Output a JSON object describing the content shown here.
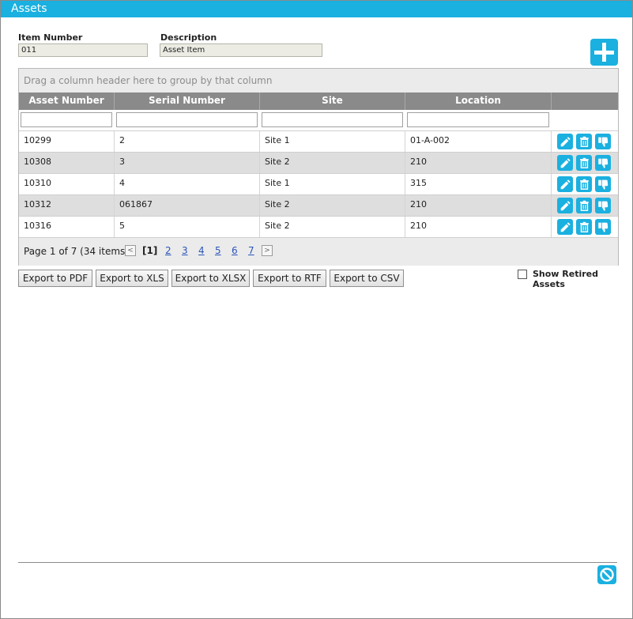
{
  "window": {
    "title": "Assets"
  },
  "fields": {
    "item_number_label": "Item Number",
    "item_number_value": "011",
    "description_label": "Description",
    "description_value": "Asset Item"
  },
  "grid": {
    "group_hint": "Drag a column header here to group by that column",
    "columns": [
      "Asset Number",
      "Serial Number",
      "Site",
      "Location"
    ],
    "rows": [
      {
        "asset_number": "10299",
        "serial_number": "2",
        "site": "Site 1",
        "location": "01-A-002"
      },
      {
        "asset_number": "10308",
        "serial_number": "3",
        "site": "Site 2",
        "location": "210"
      },
      {
        "asset_number": "10310",
        "serial_number": "4",
        "site": "Site 1",
        "location": "315"
      },
      {
        "asset_number": "10312",
        "serial_number": "061867",
        "site": "Site 2",
        "location": "210"
      },
      {
        "asset_number": "10316",
        "serial_number": "5",
        "site": "Site 2",
        "location": "210"
      }
    ],
    "row_action_icons": [
      "pencil-icon",
      "trash-icon",
      "thumbs-down-icon"
    ],
    "pager": {
      "summary": "Page 1 of 7 (34 items)",
      "prev": "<",
      "next": ">",
      "current": "[1]",
      "pages": [
        "2",
        "3",
        "4",
        "5",
        "6",
        "7"
      ]
    }
  },
  "exports": [
    "Export to PDF",
    "Export to XLS",
    "Export to XLSX",
    "Export to RTF",
    "Export to CSV"
  ],
  "show_retired": {
    "label": "Show Retired Assets",
    "checked": false
  },
  "colors": {
    "accent": "#1ab0e0",
    "header": "#8a8a8a",
    "alt_row": "#dedede"
  }
}
